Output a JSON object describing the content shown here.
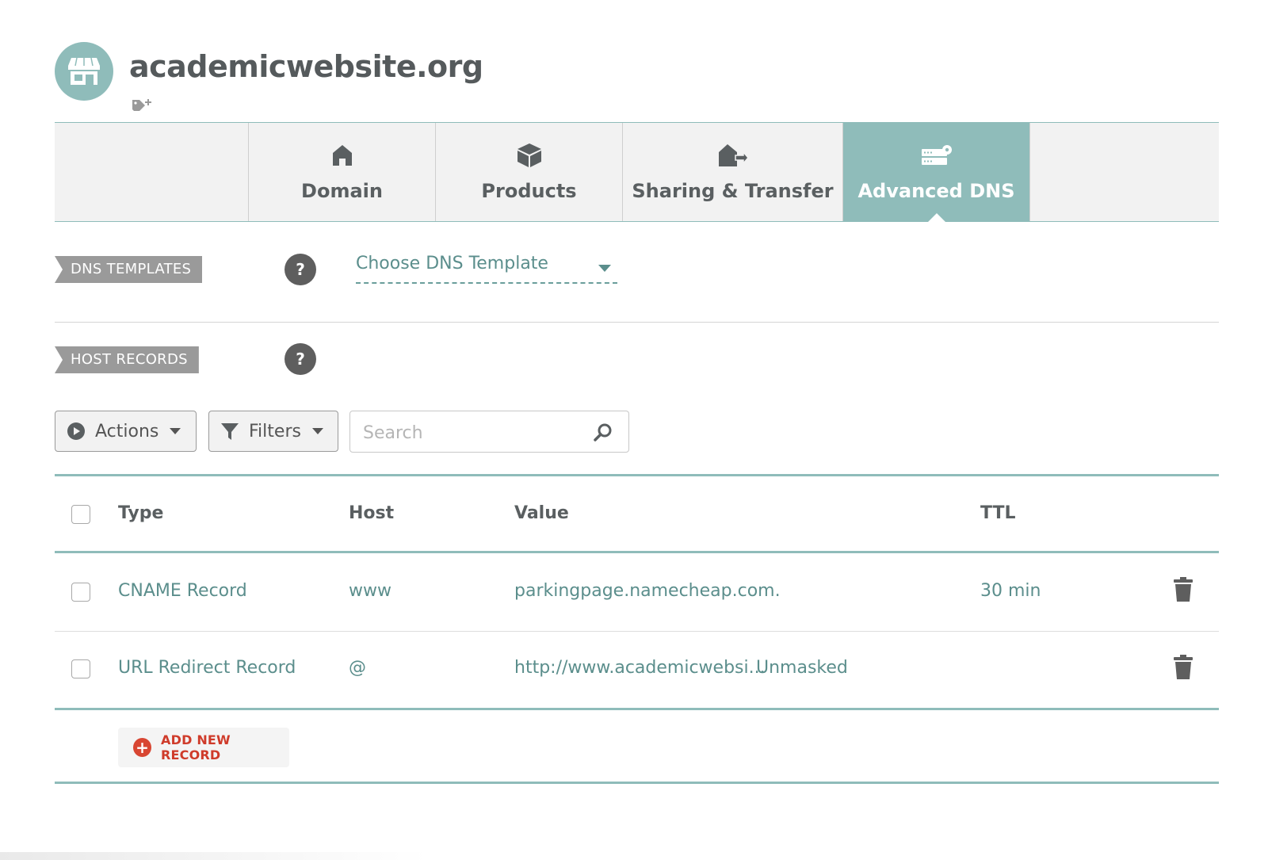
{
  "domain": {
    "name": "academicwebsite.org"
  },
  "tabs": [
    {
      "label": "Domain",
      "icon": "house-icon"
    },
    {
      "label": "Products",
      "icon": "box-icon"
    },
    {
      "label": "Sharing & Transfer",
      "icon": "house-transfer-icon"
    },
    {
      "label": "Advanced DNS",
      "icon": "server-gear-icon",
      "active": true
    }
  ],
  "dns_templates": {
    "label": "DNS TEMPLATES",
    "help": "?",
    "select_value": "Choose DNS Template"
  },
  "host_records": {
    "label": "HOST RECORDS",
    "help": "?"
  },
  "toolbar": {
    "actions_label": "Actions",
    "filters_label": "Filters",
    "search_placeholder": "Search"
  },
  "table": {
    "headers": {
      "type": "Type",
      "host": "Host",
      "value": "Value",
      "ttl": "TTL"
    },
    "rows": [
      {
        "type": "CNAME Record",
        "host": "www",
        "value": "parkingpage.namecheap.com.",
        "extra": "",
        "ttl": "30 min"
      },
      {
        "type": "URL Redirect Record",
        "host": "@",
        "value": "http://www.academicwebsi...",
        "extra": "Unmasked",
        "ttl": ""
      }
    ]
  },
  "add_record": {
    "label": "ADD NEW RECORD",
    "icon": "plus-circle-icon"
  },
  "colors": {
    "accent": "#8fbcba",
    "link": "#5b8e8c",
    "danger": "#d84632",
    "ribbon": "#9a9a9a",
    "text": "#5a5f61"
  }
}
